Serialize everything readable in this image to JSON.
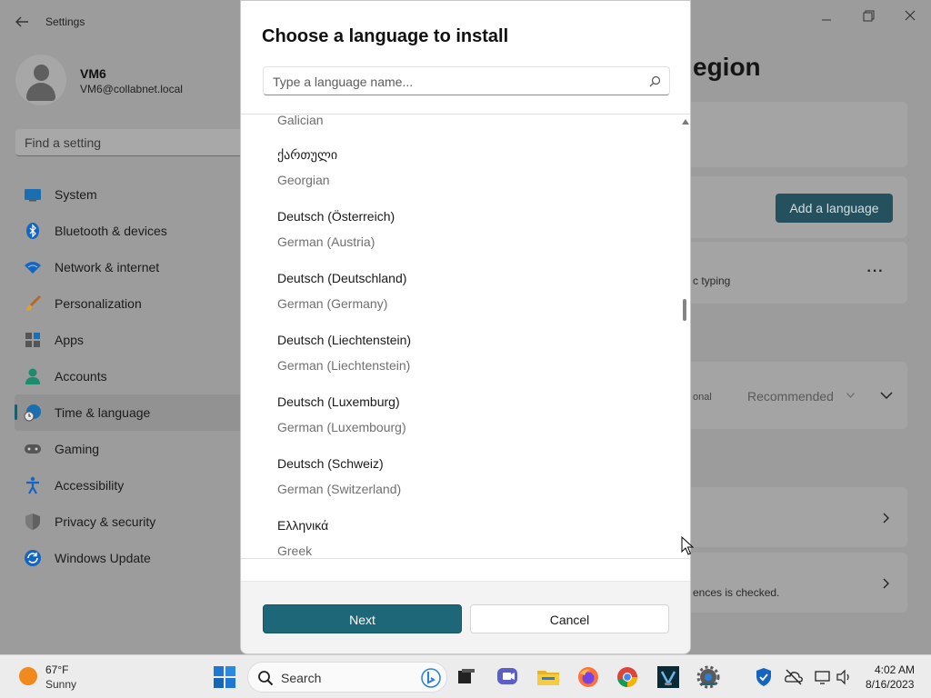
{
  "settings": {
    "app_title": "Settings",
    "user": {
      "name": "VM6",
      "email": "VM6@collabnet.local"
    },
    "find_placeholder": "Find a setting",
    "nav": [
      {
        "label": "System",
        "icon": "monitor-icon"
      },
      {
        "label": "Bluetooth & devices",
        "icon": "bluetooth-icon"
      },
      {
        "label": "Network & internet",
        "icon": "wifi-icon"
      },
      {
        "label": "Personalization",
        "icon": "paintbrush-icon"
      },
      {
        "label": "Apps",
        "icon": "apps-icon"
      },
      {
        "label": "Accounts",
        "icon": "person-icon"
      },
      {
        "label": "Time & language",
        "icon": "globe-clock-icon",
        "selected": true
      },
      {
        "label": "Gaming",
        "icon": "gamepad-icon"
      },
      {
        "label": "Accessibility",
        "icon": "accessibility-icon"
      },
      {
        "label": "Privacy & security",
        "icon": "shield-icon"
      },
      {
        "label": "Windows Update",
        "icon": "update-icon"
      }
    ],
    "page_title_partial": "egion",
    "add_language_label": "Add a language",
    "typing_text_partial": "c typing",
    "optional_text_partial": "onal",
    "recommended_value": "Recommended",
    "checked_text_partial": "ences is checked."
  },
  "dialog": {
    "title": "Choose a language to install",
    "search_placeholder": "Type a language name...",
    "partial_item_english": "Galician",
    "languages": [
      {
        "native": "ქართული",
        "english": "Georgian"
      },
      {
        "native": "Deutsch (Österreich)",
        "english": "German (Austria)"
      },
      {
        "native": "Deutsch (Deutschland)",
        "english": "German (Germany)"
      },
      {
        "native": "Deutsch (Liechtenstein)",
        "english": "German (Liechtenstein)"
      },
      {
        "native": "Deutsch (Luxemburg)",
        "english": "German (Luxembourg)"
      },
      {
        "native": "Deutsch (Schweiz)",
        "english": "German (Switzerland)"
      },
      {
        "native": "Ελληνικά",
        "english": "Greek"
      }
    ],
    "next_label": "Next",
    "cancel_label": "Cancel"
  },
  "taskbar": {
    "weather": {
      "temp": "67°F",
      "condition": "Sunny"
    },
    "search_label": "Search",
    "apps": [
      "start-button",
      "search",
      "task-view",
      "chat",
      "file-explorer",
      "firefox",
      "chrome",
      "vmware",
      "settings"
    ],
    "clock": {
      "time": "4:02 AM",
      "date": "8/16/2023"
    }
  },
  "colors": {
    "accent": "#1e6779",
    "dim_background": "#9c9c9c",
    "taskbar": "#ececec"
  }
}
